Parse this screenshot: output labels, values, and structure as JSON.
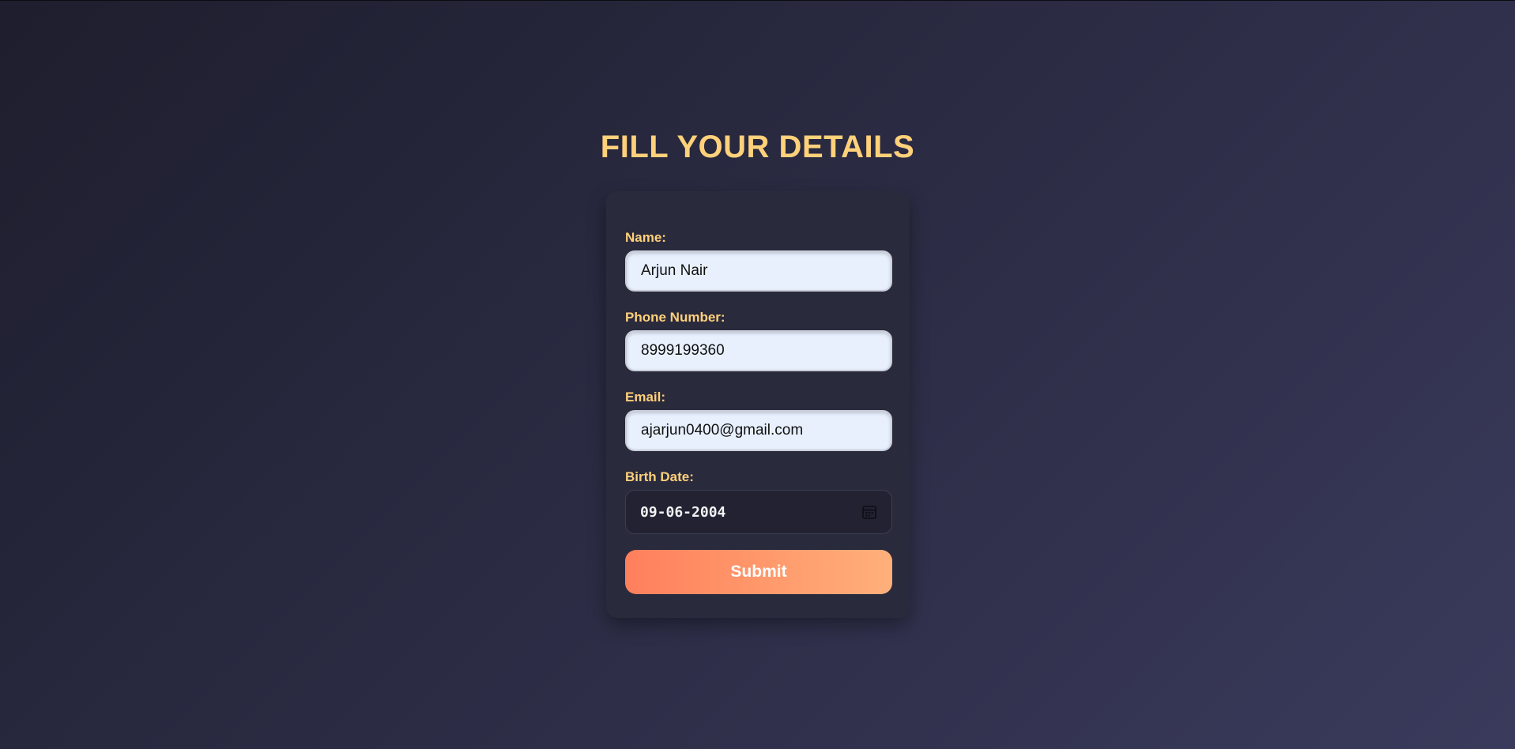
{
  "page": {
    "title": "FILL YOUR DETAILS"
  },
  "form": {
    "name_label": "Name:",
    "name_value": "Arjun Nair",
    "phone_label": "Phone Number:",
    "phone_value": "8999199360",
    "email_label": "Email:",
    "email_value": "ajarjun0400@gmail.com",
    "birth_label": "Birth Date:",
    "birth_value": "09-06-2004",
    "submit_label": "Submit"
  },
  "colors": {
    "accent": "#ffd17a",
    "button_gradient_start": "#ff7f5c",
    "button_gradient_end": "#ffb07a",
    "card_background": "#2a2a3d",
    "input_background": "#e8f0fe"
  },
  "icons": {
    "date_picker": "calendar-icon"
  }
}
